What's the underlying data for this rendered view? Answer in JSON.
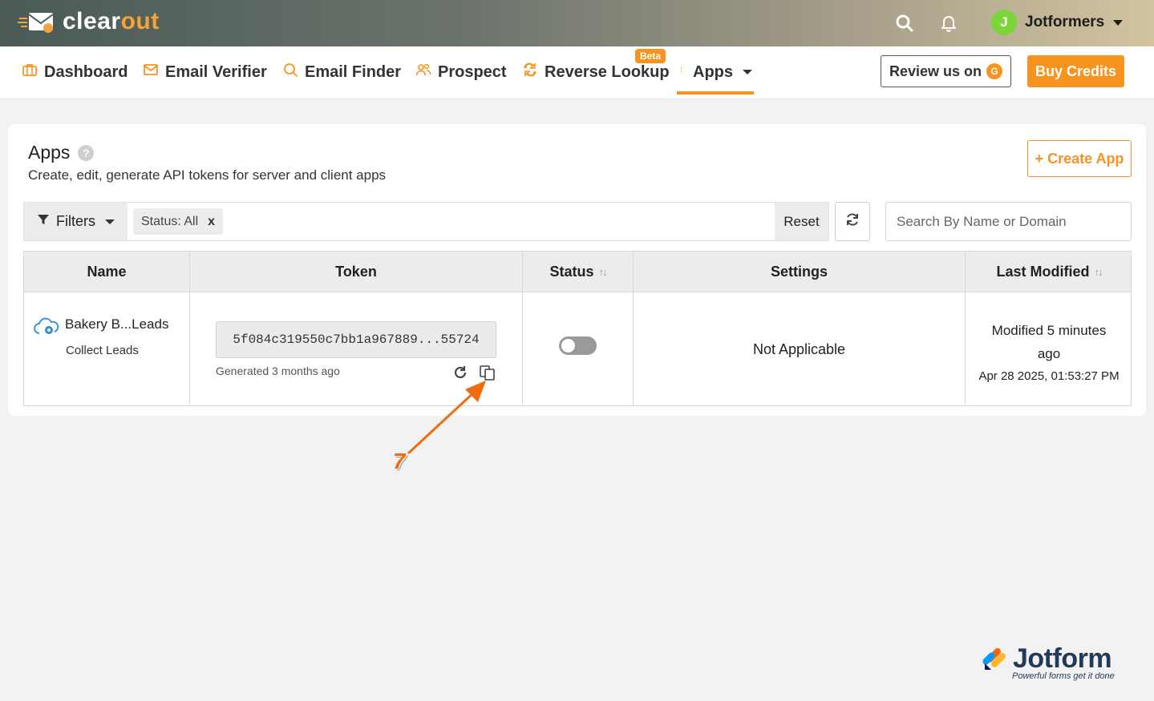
{
  "header": {
    "logo_prefix": "clear",
    "logo_suffix": "out",
    "user_initial": "J",
    "user_name": "Jotformers"
  },
  "nav": {
    "items": [
      {
        "label": "Dashboard",
        "icon": "briefcase-icon"
      },
      {
        "label": "Email Verifier",
        "icon": "envelope-icon"
      },
      {
        "label": "Email Finder",
        "icon": "search-icon"
      },
      {
        "label": "Prospect",
        "icon": "users-icon"
      },
      {
        "label": "Reverse Lookup",
        "icon": "swap-icon"
      },
      {
        "label": "Apps",
        "icon": "kebab-icon"
      }
    ],
    "beta_badge": "Beta",
    "review_label": "Review us on",
    "g2_label": "G",
    "buy_label": "Buy Credits",
    "active": "Apps"
  },
  "page": {
    "title": "Apps",
    "help": "?",
    "subtitle": "Create, edit, generate API tokens for server and client apps",
    "create_label": "+ Create App",
    "filters_label": "Filters",
    "chip_label": "Status: All",
    "chip_remove": "x",
    "reset_label": "Reset",
    "search_placeholder": "Search By Name or Domain"
  },
  "table": {
    "columns": [
      "Name",
      "Token",
      "Status",
      "Settings",
      "Last Modified"
    ],
    "sort_symbol": "↑↓",
    "row": {
      "name": "Bakery B...Leads",
      "subtitle": "Collect Leads",
      "token": "5f084c319550c7bb1a967889...55724",
      "generated": "Generated 3 months ago",
      "status_on": false,
      "settings": "Not Applicable",
      "modified_line1": "Modified 5 minutes",
      "modified_line2": "ago",
      "modified_date": "Apr 28 2025, 01:53:27 PM"
    }
  },
  "annotation": {
    "step": "7",
    "color": "#f26b0f"
  },
  "watermark": {
    "brand": "Jotform",
    "tagline": "Powerful forms get it done"
  },
  "colors": {
    "accent": "#f7931e",
    "success": "#7bd63a"
  }
}
